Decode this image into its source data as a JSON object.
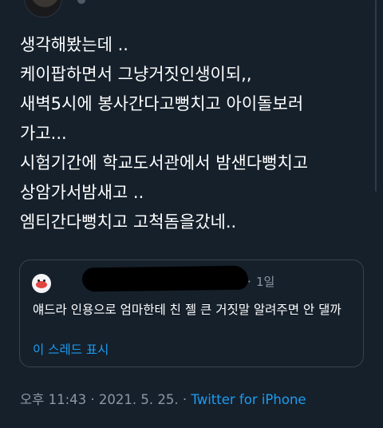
{
  "tweet": {
    "lines": [
      "생각해봤는데 ..",
      "케이팝하면서 그냥거짓인생이되,,",
      "새벽5시에 봉사간다고뻥치고 아이돌보러",
      "가고...",
      "시험기간에 학교도서관에서 밤샌다뻥치고",
      "상암가서밤새고 ..",
      "엠티간다뻥치고 고척돔을갔네.."
    ]
  },
  "quote": {
    "separator": "·",
    "time": "1일",
    "text": "얘드라 인용으로 엄마한테 친 젤 큰 거짓말 알려주면 안 댈까",
    "thread_link": "이 스레드 표시"
  },
  "meta": {
    "time": "오후 11:43",
    "separator": "·",
    "date": "2021. 5. 25.",
    "source": "Twitter for iPhone"
  },
  "colors": {
    "background": "#15202b",
    "text": "#ffffff",
    "secondary": "#8b98a5",
    "link": "#1d9bf0",
    "border": "#38444d"
  }
}
